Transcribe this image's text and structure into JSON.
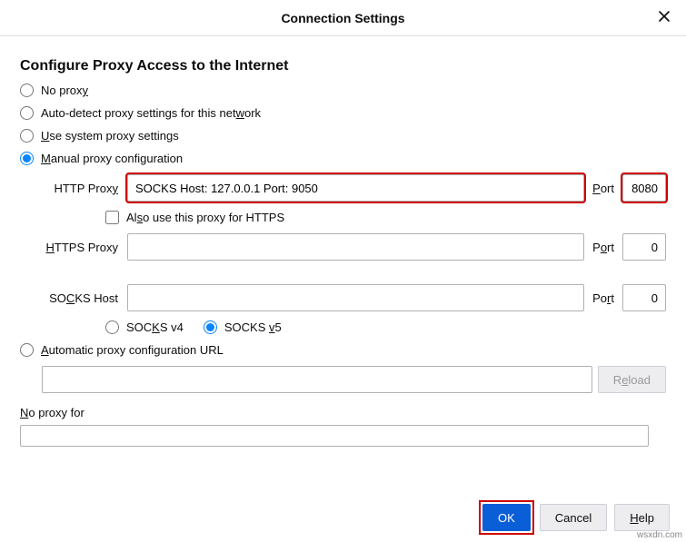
{
  "title": "Connection Settings",
  "section_heading": "Configure Proxy Access to the Internet",
  "radios": {
    "no_proxy": "No proxy",
    "auto_detect": "Auto-detect proxy settings for this network",
    "system": "Use system proxy settings",
    "manual": "Manual proxy configuration",
    "pac": "Automatic proxy configuration URL"
  },
  "labels": {
    "http_proxy": "HTTP Proxy",
    "also_https": "Also use this proxy for HTTPS",
    "https_proxy": "HTTPS Proxy",
    "socks_host": "SOCKS Host",
    "port": "Port",
    "socks_v4": "SOCKS v4",
    "socks_v5": "SOCKS v5",
    "reload": "Reload",
    "no_proxy_for": "No proxy for"
  },
  "values": {
    "http_host": "SOCKS Host: 127.0.0.1 Port: 9050",
    "http_port": "8080",
    "https_host": "",
    "https_port": "0",
    "socks_host": "",
    "socks_port": "0",
    "pac_url": "",
    "no_proxy_list": ""
  },
  "buttons": {
    "ok": "OK",
    "cancel": "Cancel",
    "help": "Help"
  },
  "watermark": "wsxdn.com"
}
